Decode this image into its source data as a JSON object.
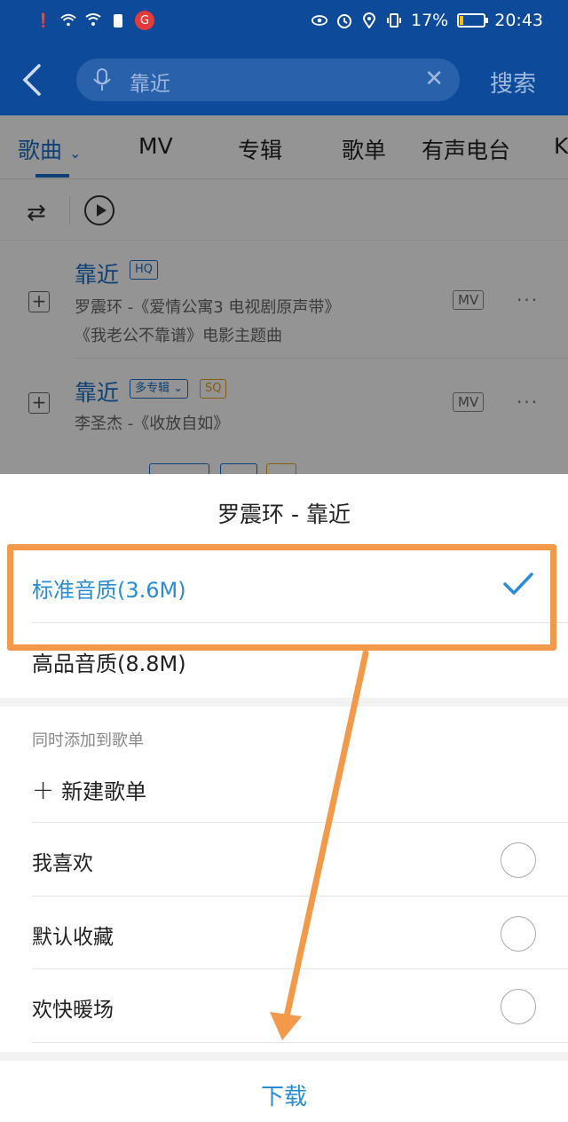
{
  "status_bar": {
    "battery_percent": "17%",
    "battery_level": 0.17,
    "time": "20:43",
    "app_glyph": "G"
  },
  "header": {
    "back_icon": "back-arrow-icon",
    "search_value": "靠近",
    "search_button": "搜索"
  },
  "tabs": [
    {
      "label": "歌曲"
    },
    {
      "label": "MV"
    },
    {
      "label": "专辑"
    },
    {
      "label": "歌单"
    },
    {
      "label": "有声电台"
    },
    {
      "label": "K"
    }
  ],
  "songs": [
    {
      "title": "靠近",
      "badges": [
        "HQ"
      ],
      "subtitle_line1": "罗震环 -《爱情公寓3 电视剧原声带》",
      "subtitle_line2": "《我老公不靠谱》电影主题曲",
      "mv": "MV",
      "more": "···"
    },
    {
      "title": "靠近",
      "badges": [
        "多专辑",
        "SQ"
      ],
      "subtitle_line1": "李圣杰 -《收放自如》",
      "mv": "MV",
      "more": "···"
    }
  ],
  "sheet": {
    "title": "罗震环 - 靠近",
    "quality_options": [
      {
        "label": "标准音质(3.6M)",
        "selected": true
      },
      {
        "label": "高品音质(8.8M)",
        "selected": false
      }
    ],
    "also_add_label": "同时添加到歌单",
    "new_playlist": "新建歌单",
    "playlists": [
      {
        "label": "我喜欢"
      },
      {
        "label": "默认收藏"
      },
      {
        "label": "欢快暖场"
      }
    ],
    "download_button": "下载"
  },
  "colors": {
    "header_blue": "#0d4b9a",
    "accent_blue": "#2a8dd4",
    "annotation_orange": "#f29a4a"
  }
}
